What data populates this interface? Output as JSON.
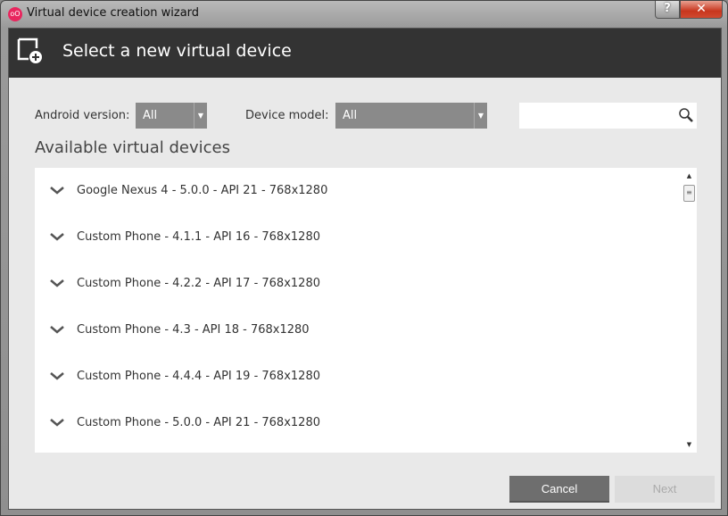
{
  "window": {
    "title": "Virtual device creation wizard",
    "help": "?",
    "close": "✕",
    "app_icon": "oO"
  },
  "header": {
    "title": "Select a new virtual device"
  },
  "filters": {
    "android_version_label": "Android version:",
    "android_version_value": "All",
    "device_model_label": "Device model:",
    "device_model_value": "All",
    "search_placeholder": ""
  },
  "list": {
    "title": "Available virtual devices",
    "items": [
      "Google Nexus 4 - 5.0.0 - API 21 - 768x1280",
      "Custom Phone - 4.1.1 - API 16 - 768x1280",
      "Custom Phone - 4.2.2 - API 17 - 768x1280",
      "Custom Phone - 4.3 - API 18 - 768x1280",
      "Custom Phone - 4.4.4 - API 19 - 768x1280",
      "Custom Phone - 5.0.0 - API 21 - 768x1280"
    ]
  },
  "buttons": {
    "cancel": "Cancel",
    "next": "Next"
  }
}
